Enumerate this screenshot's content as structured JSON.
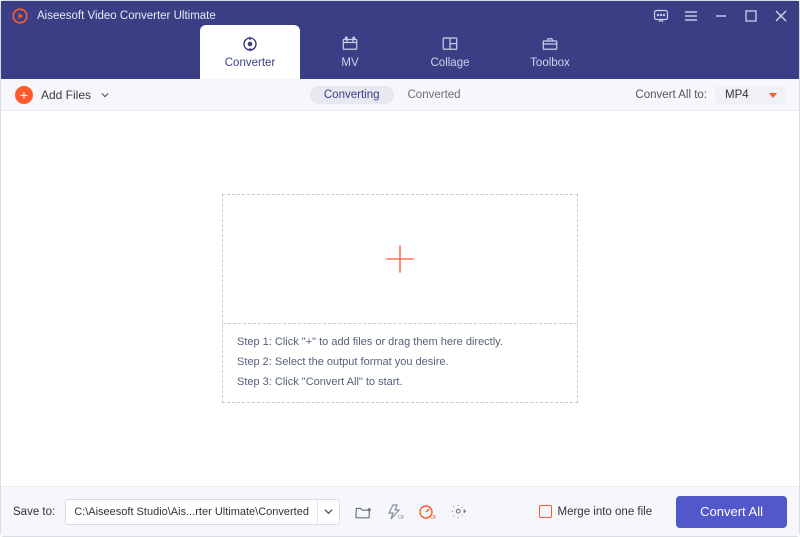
{
  "app": {
    "title": "Aiseesoft Video Converter Ultimate"
  },
  "tabs": {
    "converter": "Converter",
    "mv": "MV",
    "collage": "Collage",
    "toolbox": "Toolbox"
  },
  "toolbar": {
    "add_files": "Add Files",
    "converting": "Converting",
    "converted": "Converted",
    "convert_all_to": "Convert All to:",
    "format": "MP4"
  },
  "drop": {
    "step1": "Step 1: Click \"+\" to add files or drag them here directly.",
    "step2": "Step 2: Select the output format you desire.",
    "step3": "Step 3: Click \"Convert All\" to start."
  },
  "footer": {
    "save_to": "Save to:",
    "path": "C:\\Aiseesoft Studio\\Ais...rter Ultimate\\Converted",
    "merge": "Merge into one file",
    "convert_all": "Convert All"
  }
}
